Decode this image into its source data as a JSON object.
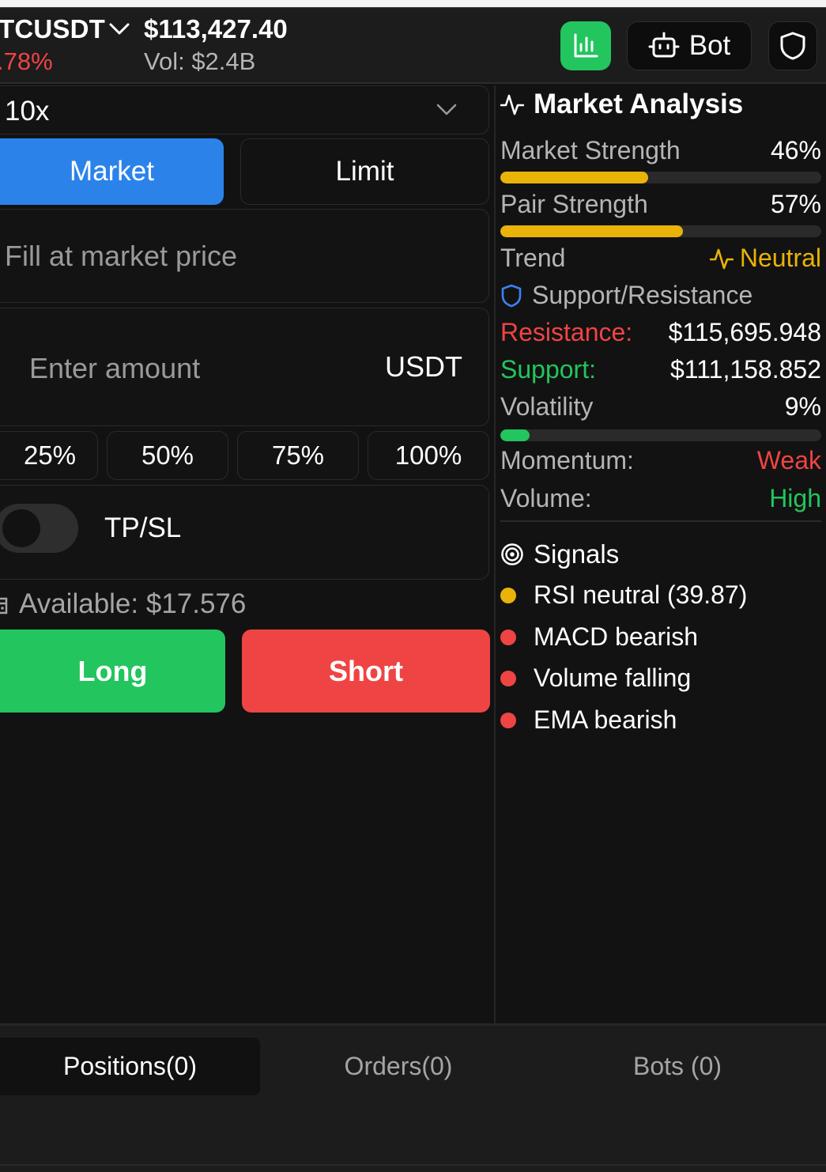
{
  "header": {
    "pair": "TCUSDT",
    "change": ".78%",
    "price": "$113,427.40",
    "volume": "Vol: $2.4B",
    "bot_label": "Bot",
    "icons": [
      "chevron-down-icon",
      "bar-chart-icon",
      "bot-icon",
      "shield-icon"
    ]
  },
  "order": {
    "leverage": "10x",
    "tabs": {
      "market": "Market",
      "limit": "Limit"
    },
    "price_text": "Fill at market price",
    "amount_placeholder": "Enter amount",
    "amount_currency": "USDT",
    "percent_buttons": [
      "25%",
      "50%",
      "75%",
      "100%"
    ],
    "tpsl_label": "TP/SL",
    "tpsl_enabled": false,
    "available": "Available: $17.576",
    "long_label": "Long",
    "short_label": "Short"
  },
  "analysis": {
    "title": "Market Analysis",
    "market_strength": {
      "label": "Market Strength",
      "value": "46%",
      "level": 0.46
    },
    "pair_strength": {
      "label": "Pair Strength",
      "value": "57%",
      "level": 0.57
    },
    "trend": {
      "label": "Trend",
      "value": "Neutral"
    },
    "sr_title": "Support/Resistance",
    "resistance": {
      "label": "Resistance:",
      "value": "$115,695.948"
    },
    "support": {
      "label": "Support:",
      "value": "$111,158.852"
    },
    "volatility": {
      "label": "Volatility",
      "value": "9%",
      "level": 0.09
    },
    "momentum": {
      "label": "Momentum:",
      "value": "Weak"
    },
    "volume": {
      "label": "Volume:",
      "value": "High"
    },
    "signals_title": "Signals",
    "signals": [
      {
        "text": "RSI neutral (39.87)",
        "color": "#eab308"
      },
      {
        "text": "MACD bearish",
        "color": "#ef4444"
      },
      {
        "text": "Volume falling",
        "color": "#ef4444"
      },
      {
        "text": "EMA bearish",
        "color": "#ef4444"
      }
    ]
  },
  "colors": {
    "accent_blue": "#2b83ea",
    "green": "#22c55e",
    "red": "#ef4444",
    "yellow": "#eab308"
  },
  "bottom_tabs": [
    "Positions(0)",
    "Orders(0)",
    "Bots (0)"
  ]
}
